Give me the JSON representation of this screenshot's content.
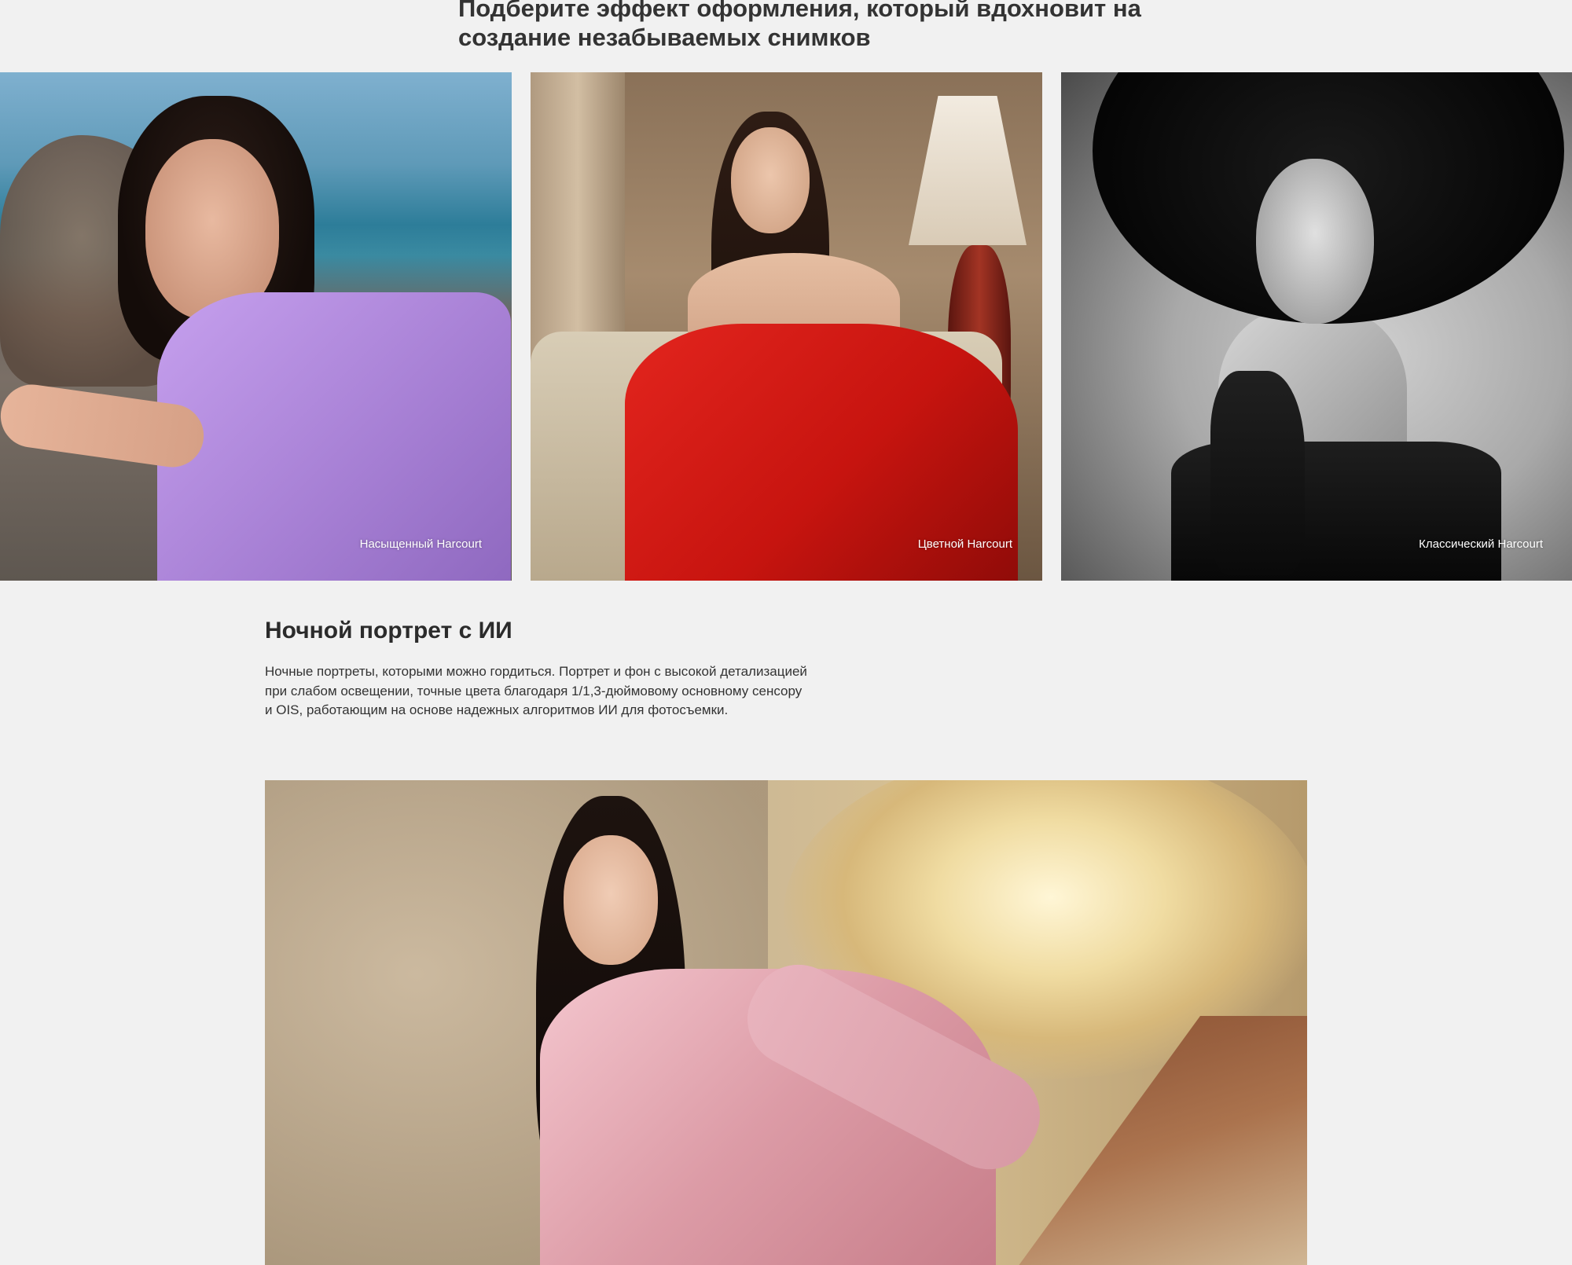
{
  "headline": "Подберите эффект оформления, который вдохновит на создание незабываемых снимков",
  "styles": [
    {
      "caption": "Насыщенный Harcourt"
    },
    {
      "caption": "Цветной Harcourt"
    },
    {
      "caption": "Классический Harcourt"
    }
  ],
  "night_portrait": {
    "title": "Ночной портрет с ИИ",
    "description": "Ночные портреты, которыми можно гордиться. Портрет и фон с высокой детализацией при слабом освещении, точные цвета благодаря 1/1,3-дюймовому основному сенсору и OIS, работающим на основе надежных алгоритмов ИИ для фотосъемки."
  },
  "colors": {
    "background": "#f1f1f1",
    "text": "#2a2a2a",
    "caption": "#ffffff"
  }
}
